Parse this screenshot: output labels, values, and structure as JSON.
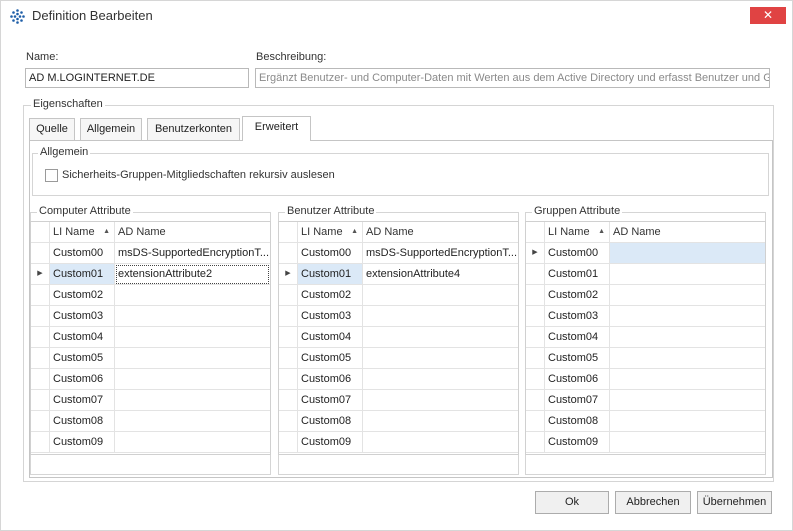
{
  "window": {
    "title": "Definition Bearbeiten",
    "close_glyph": "✕"
  },
  "fields": {
    "name_label": "Name:",
    "name_value": "AD M.LOGINTERNET.DE",
    "desc_label": "Beschreibung:",
    "desc_value": "Ergänzt Benutzer- und Computer-Daten mit Werten aus dem Active Directory und erfasst Benutzer und Gr"
  },
  "properties": {
    "legend": "Eigenschaften",
    "tabs": [
      "Quelle",
      "Allgemein",
      "Benutzerkonten",
      "Erweitert"
    ],
    "active_tab": "Erweitert"
  },
  "general": {
    "legend": "Allgemein",
    "checkbox_label": "Sicherheits-Gruppen-Mitgliedschaften rekursiv auslesen",
    "checked": false
  },
  "grids": [
    {
      "legend": "Computer Attribute",
      "col_li": "LI Name",
      "col_ad": "AD Name",
      "rows": [
        {
          "li": "Custom00",
          "ad": "msDS-SupportedEncryptionT..."
        },
        {
          "li": "Custom01",
          "ad": "extensionAttribute2"
        },
        {
          "li": "Custom02",
          "ad": ""
        },
        {
          "li": "Custom03",
          "ad": ""
        },
        {
          "li": "Custom04",
          "ad": ""
        },
        {
          "li": "Custom05",
          "ad": ""
        },
        {
          "li": "Custom06",
          "ad": ""
        },
        {
          "li": "Custom07",
          "ad": ""
        },
        {
          "li": "Custom08",
          "ad": ""
        },
        {
          "li": "Custom09",
          "ad": ""
        }
      ]
    },
    {
      "legend": "Benutzer Attribute",
      "col_li": "LI Name",
      "col_ad": "AD Name",
      "rows": [
        {
          "li": "Custom00",
          "ad": "msDS-SupportedEncryptionT..."
        },
        {
          "li": "Custom01",
          "ad": "extensionAttribute4"
        },
        {
          "li": "Custom02",
          "ad": ""
        },
        {
          "li": "Custom03",
          "ad": ""
        },
        {
          "li": "Custom04",
          "ad": ""
        },
        {
          "li": "Custom05",
          "ad": ""
        },
        {
          "li": "Custom06",
          "ad": ""
        },
        {
          "li": "Custom07",
          "ad": ""
        },
        {
          "li": "Custom08",
          "ad": ""
        },
        {
          "li": "Custom09",
          "ad": ""
        }
      ]
    },
    {
      "legend": "Gruppen Attribute",
      "col_li": "LI Name",
      "col_ad": "AD Name",
      "rows": [
        {
          "li": "Custom00",
          "ad": ""
        },
        {
          "li": "Custom01",
          "ad": ""
        },
        {
          "li": "Custom02",
          "ad": ""
        },
        {
          "li": "Custom03",
          "ad": ""
        },
        {
          "li": "Custom04",
          "ad": ""
        },
        {
          "li": "Custom05",
          "ad": ""
        },
        {
          "li": "Custom06",
          "ad": ""
        },
        {
          "li": "Custom07",
          "ad": ""
        },
        {
          "li": "Custom08",
          "ad": ""
        },
        {
          "li": "Custom09",
          "ad": ""
        }
      ]
    }
  ],
  "buttons": {
    "ok": "Ok",
    "cancel": "Abbrechen",
    "apply": "Übernehmen"
  },
  "colors": {
    "close_red": "#e04343",
    "selection": "#dbe9f7",
    "app_icon_blue": "#1f5fa8"
  },
  "icons": {
    "app": "grid-dots-icon",
    "close": "close-icon",
    "sort": "sort-ascending-icon",
    "row_pointer": "row-pointer-icon"
  }
}
